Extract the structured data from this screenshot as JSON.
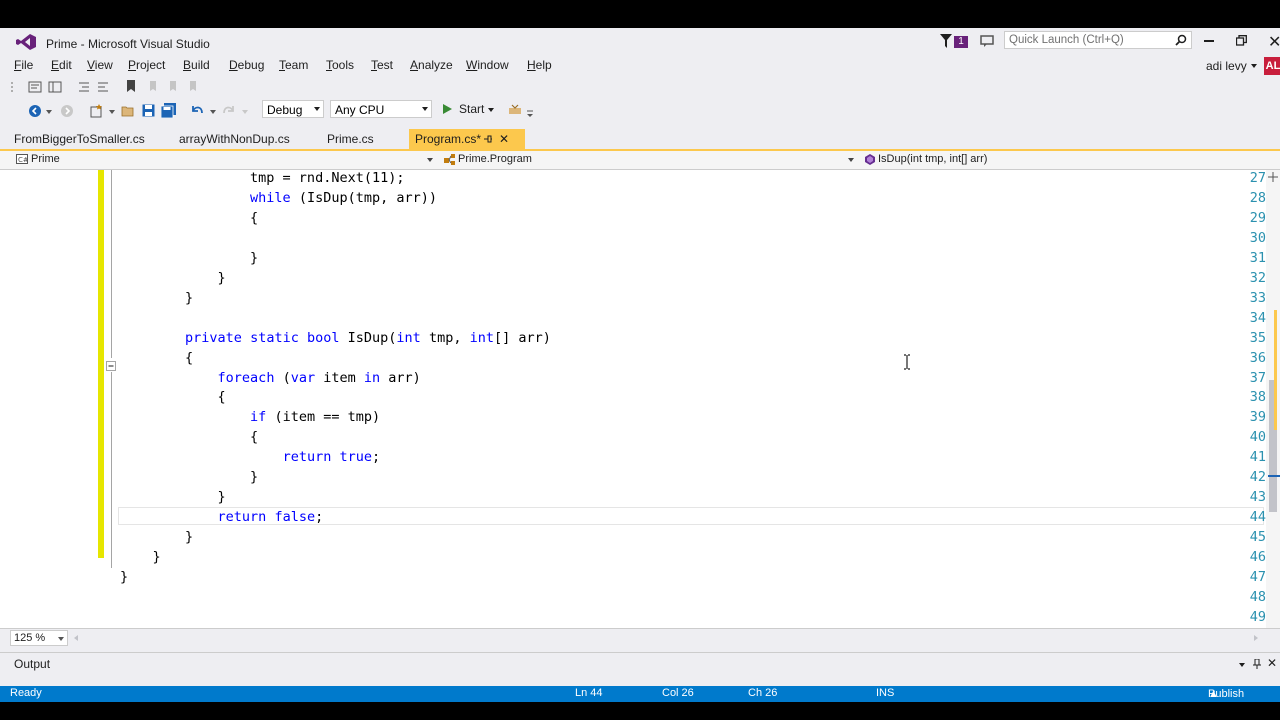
{
  "window": {
    "title": "Prime - Microsoft Visual Studio",
    "notification_count": "1",
    "quick_launch_placeholder": "Quick Launch (Ctrl+Q)",
    "user_name": "adi levy",
    "user_initials": "AL"
  },
  "menu": {
    "items": [
      "File",
      "Edit",
      "View",
      "Project",
      "Build",
      "Debug",
      "Team",
      "Tools",
      "Test",
      "Analyze",
      "Window",
      "Help"
    ]
  },
  "toolbar": {
    "configuration": "Debug",
    "platform": "Any CPU",
    "start_label": "Start"
  },
  "tabs": [
    {
      "label": "FromBiggerToSmaller.cs"
    },
    {
      "label": "arrayWithNonDup.cs"
    },
    {
      "label": "Prime.cs"
    },
    {
      "label": "Program.cs*",
      "active": true
    }
  ],
  "navbar": {
    "project": "Prime",
    "type": "Prime.Program",
    "member": "IsDup(int tmp, int[] arr)"
  },
  "editor": {
    "lines": [
      {
        "n": "27",
        "text": "                tmp = rnd.Next(11);"
      },
      {
        "n": "28",
        "text": "                while (IsDup(tmp, arr))"
      },
      {
        "n": "29",
        "text": "                {"
      },
      {
        "n": "30",
        "text": ""
      },
      {
        "n": "31",
        "text": "                }"
      },
      {
        "n": "32",
        "text": "            }"
      },
      {
        "n": "33",
        "text": "        }"
      },
      {
        "n": "34",
        "text": ""
      },
      {
        "n": "35",
        "text": "        private static bool IsDup(int tmp, int[] arr)"
      },
      {
        "n": "36",
        "text": "        {"
      },
      {
        "n": "37",
        "text": "            foreach (var item in arr)"
      },
      {
        "n": "38",
        "text": "            {"
      },
      {
        "n": "39",
        "text": "                if (item == tmp)"
      },
      {
        "n": "40",
        "text": "                {"
      },
      {
        "n": "41",
        "text": "                    return true;"
      },
      {
        "n": "42",
        "text": "                }"
      },
      {
        "n": "43",
        "text": "            }"
      },
      {
        "n": "44",
        "text": "            return false;"
      },
      {
        "n": "45",
        "text": "        }"
      },
      {
        "n": "46",
        "text": "    }"
      },
      {
        "n": "47",
        "text": "}"
      },
      {
        "n": "48",
        "text": ""
      },
      {
        "n": "49",
        "text": ""
      }
    ]
  },
  "zoom": "125 %",
  "output_panel": {
    "title": "Output"
  },
  "status": {
    "state": "Ready",
    "line": "Ln 44",
    "col": "Col 26",
    "ch": "Ch 26",
    "mode": "INS",
    "publish": "Publish"
  },
  "colors": {
    "accent": "#007acc",
    "active_tab": "#fcc84d",
    "keyword": "#0000ff",
    "line_number": "#2b91af",
    "change_marker": "#e6e600"
  }
}
